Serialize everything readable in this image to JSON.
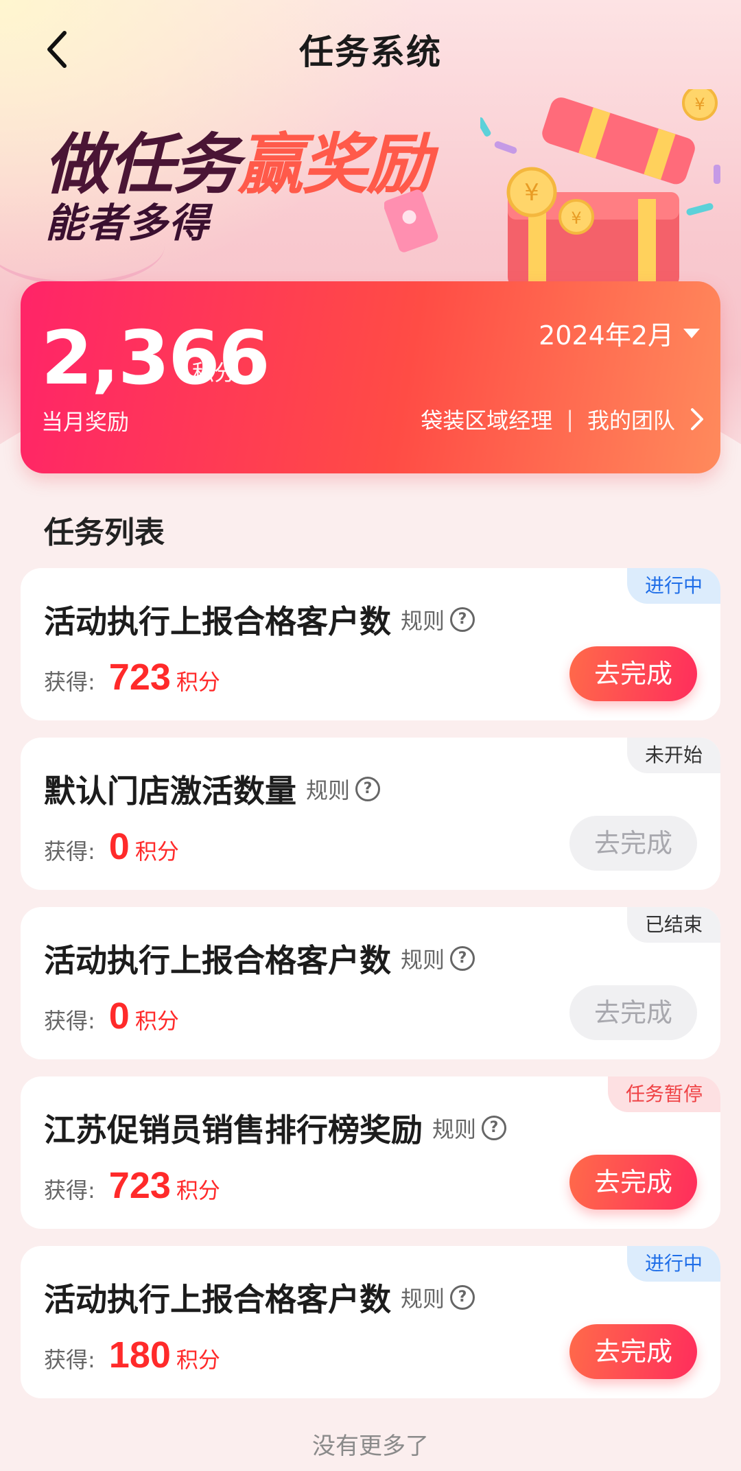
{
  "header": {
    "title": "任务系统"
  },
  "banner": {
    "slogan_part1": "做任务",
    "slogan_part2": "赢奖励",
    "slogan_line2": "能者多得"
  },
  "summary": {
    "points": "2,366",
    "points_unit": "积分",
    "label": "当月奖励",
    "month": "2024年2月",
    "role": "袋装区域经理",
    "separator": "|",
    "team_link": "我的团队"
  },
  "section": {
    "title": "任务列表"
  },
  "tasks": [
    {
      "name": "活动执行上报合格客户数",
      "rule": "规则",
      "earn_label": "获得:",
      "points": "723",
      "unit": "积分",
      "status": "进行中",
      "button": "去完成"
    },
    {
      "name": "默认门店激活数量",
      "rule": "规则",
      "earn_label": "获得:",
      "points": "0",
      "unit": "积分",
      "status": "未开始",
      "button": "去完成"
    },
    {
      "name": "活动执行上报合格客户数",
      "rule": "规则",
      "earn_label": "获得:",
      "points": "0",
      "unit": "积分",
      "status": "已结束",
      "button": "去完成"
    },
    {
      "name": "江苏促销员销售排行榜奖励",
      "rule": "规则",
      "earn_label": "获得:",
      "points": "723",
      "unit": "积分",
      "status": "任务暂停",
      "button": "去完成"
    },
    {
      "name": "活动执行上报合格客户数",
      "rule": "规则",
      "earn_label": "获得:",
      "points": "180",
      "unit": "积分",
      "status": "进行中",
      "button": "去完成"
    }
  ],
  "footer": {
    "text": "没有更多了"
  },
  "colors": {
    "accent": "#ff2468",
    "points_red": "#ff2a2a",
    "status_blue": "#1f6ee8",
    "status_red": "#ef4245"
  }
}
